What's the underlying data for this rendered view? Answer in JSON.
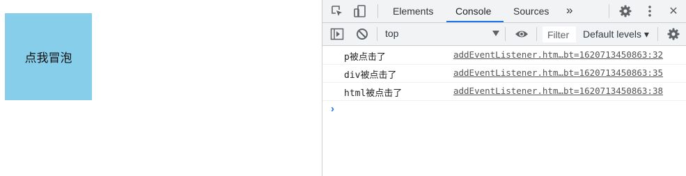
{
  "page": {
    "bubble_text": "点我冒泡",
    "bubble_color": "#87ceeb"
  },
  "devtools": {
    "tabs": [
      "Elements",
      "Console",
      "Sources"
    ],
    "active_tab": "Console",
    "more_tabs_glyph": "»",
    "close_glyph": "✕",
    "icons": [
      "inspect-element-icon",
      "device-toolbar-icon",
      "gear-icon",
      "more-vertical-icon",
      "close-icon"
    ],
    "filter_toolbar": {
      "context": "top",
      "filter_placeholder": "Filter",
      "levels": "Default levels ▾",
      "icons": [
        "show-sidebar-icon",
        "clear-console-icon",
        "live-expression-eye-icon",
        "settings-gear-icon"
      ]
    },
    "console_messages": [
      {
        "text": "p被点击了",
        "source": "addEventListener.htm…bt=1620713450863:32"
      },
      {
        "text": "div被点击了",
        "source": "addEventListener.htm…bt=1620713450863:35"
      },
      {
        "text": "html被点击了",
        "source": "addEventListener.htm…bt=1620713450863:38"
      }
    ],
    "prompt_glyph": "›",
    "accent_color": "#1a73e8"
  }
}
